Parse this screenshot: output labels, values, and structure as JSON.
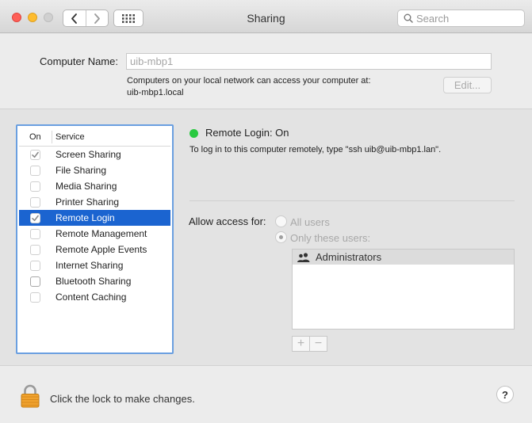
{
  "window": {
    "title": "Sharing"
  },
  "search": {
    "placeholder": "Search"
  },
  "computer_name": {
    "label": "Computer Name:",
    "value": "uib-mbp1",
    "description_line1": "Computers on your local network can access your computer at:",
    "description_line2": "uib-mbp1.local",
    "edit_label": "Edit..."
  },
  "services": {
    "header_on": "On",
    "header_service": "Service",
    "items": [
      {
        "name": "Screen Sharing",
        "checked": true,
        "selected": false
      },
      {
        "name": "File Sharing",
        "checked": false,
        "selected": false
      },
      {
        "name": "Media Sharing",
        "checked": false,
        "selected": false
      },
      {
        "name": "Printer Sharing",
        "checked": false,
        "selected": false
      },
      {
        "name": "Remote Login",
        "checked": true,
        "selected": true
      },
      {
        "name": "Remote Management",
        "checked": false,
        "selected": false
      },
      {
        "name": "Remote Apple Events",
        "checked": false,
        "selected": false
      },
      {
        "name": "Internet Sharing",
        "checked": false,
        "selected": false
      },
      {
        "name": "Bluetooth Sharing",
        "checked": false,
        "selected": false
      },
      {
        "name": "Content Caching",
        "checked": false,
        "selected": false
      }
    ]
  },
  "detail": {
    "status": "Remote Login: On",
    "status_color": "#29c940",
    "instructions": "To log in to this computer remotely, type \"ssh uib@uib-mbp1.lan\".",
    "allow_access_label": "Allow access for:",
    "option_all_users": "All users",
    "option_only_these": "Only these users:",
    "selected_option": "only_these",
    "users": [
      {
        "name": "Administrators",
        "icon": "group-icon"
      }
    ],
    "add_label": "+",
    "remove_label": "−"
  },
  "footer": {
    "lock_text": "Click the lock to make changes.",
    "help_label": "?"
  },
  "colors": {
    "selection": "#1b64d0",
    "list_border": "#6a9fe0"
  }
}
